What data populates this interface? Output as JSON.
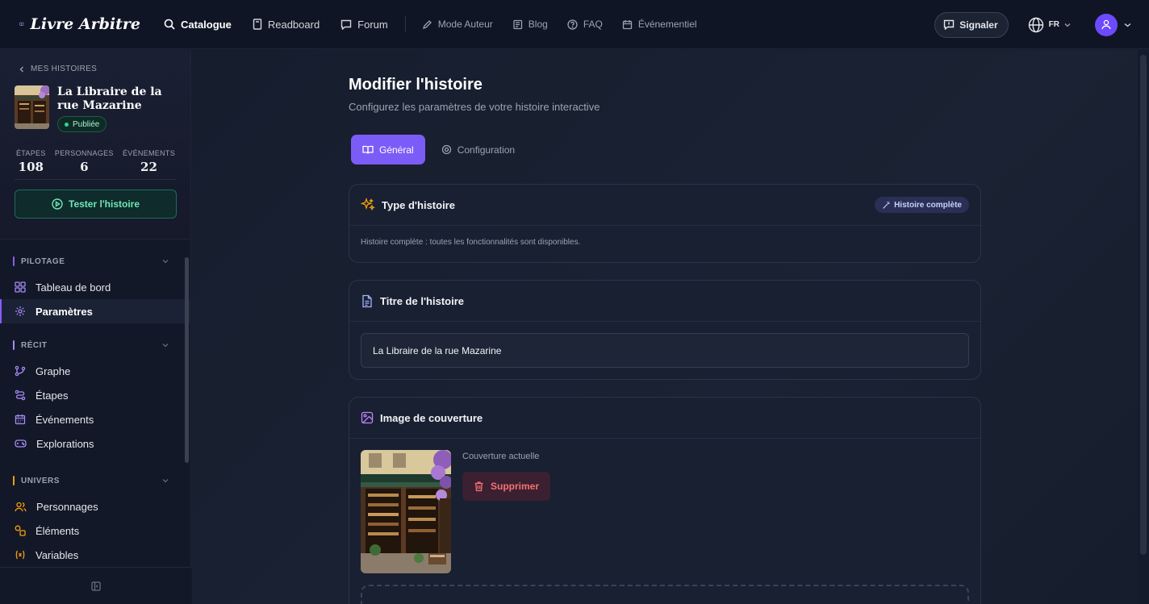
{
  "header": {
    "logo_text": "Livre Arbitre",
    "nav": [
      {
        "label": "Catalogue",
        "icon": "search-icon"
      },
      {
        "label": "Readboard",
        "icon": "book-icon"
      },
      {
        "label": "Forum",
        "icon": "chat-icon"
      }
    ],
    "nav_secondary": [
      {
        "label": "Mode Auteur",
        "icon": "pen-icon"
      },
      {
        "label": "Blog",
        "icon": "newspaper-icon"
      },
      {
        "label": "FAQ",
        "icon": "help-icon"
      },
      {
        "label": "Événementiel",
        "icon": "calendar-icon"
      }
    ],
    "report_label": "Signaler",
    "lang": "FR"
  },
  "sidebar": {
    "back_label": "MES HISTOIRES",
    "story_title": "La Libraire de la rue Mazarine",
    "status": "Publiée",
    "stats": [
      {
        "label": "ÉTAPES",
        "value": "108"
      },
      {
        "label": "PERSONNAGES",
        "value": "6"
      },
      {
        "label": "ÉVÉNEMENTS",
        "value": "22"
      }
    ],
    "test_label": "Tester l'histoire",
    "sections": [
      {
        "title": "PILOTAGE",
        "color": "#8b5cf6",
        "items": [
          {
            "label": "Tableau de bord",
            "icon": "dashboard-icon"
          },
          {
            "label": "Paramètres",
            "icon": "gear-icon",
            "active": true
          }
        ]
      },
      {
        "title": "RÉCIT",
        "color": "#a78bfa",
        "items": [
          {
            "label": "Graphe",
            "icon": "graph-icon"
          },
          {
            "label": "Étapes",
            "icon": "route-icon"
          },
          {
            "label": "Événements",
            "icon": "calendar-icon"
          },
          {
            "label": "Explorations",
            "icon": "gamepad-icon"
          }
        ]
      },
      {
        "title": "UNIVERS",
        "color": "#f59e0b",
        "items": [
          {
            "label": "Personnages",
            "icon": "users-icon"
          },
          {
            "label": "Éléments",
            "icon": "shapes-icon"
          },
          {
            "label": "Variables",
            "icon": "variable-icon"
          }
        ]
      }
    ]
  },
  "main": {
    "title": "Modifier l'histoire",
    "subtitle": "Configurez les paramètres de votre histoire interactive",
    "tabs": [
      {
        "label": "Général",
        "icon": "book-open-icon",
        "active": true
      },
      {
        "label": "Configuration",
        "icon": "gear-icon",
        "active": false
      }
    ],
    "type_card": {
      "title": "Type d'histoire",
      "badge": "Histoire complète",
      "description": "Histoire complète : toutes les fonctionnalités sont disponibles."
    },
    "title_card": {
      "title": "Titre de l'histoire",
      "value": "La Libraire de la rue Mazarine"
    },
    "cover_card": {
      "title": "Image de couverture",
      "current_label": "Couverture actuelle",
      "delete_label": "Supprimer"
    }
  },
  "colors": {
    "accent": "#7c5cf7",
    "published": "#34d399",
    "danger": "#f87171"
  }
}
